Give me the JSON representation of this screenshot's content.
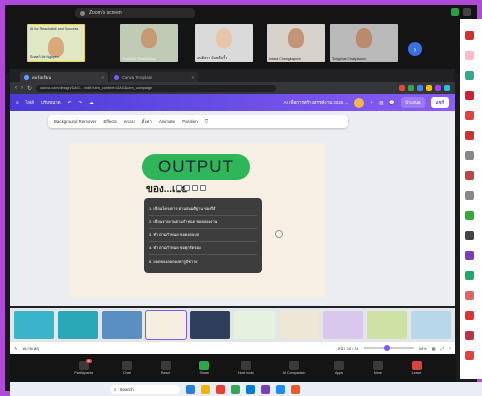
{
  "zoom": {
    "title": "Zoom's screen",
    "participants": [
      {
        "name": "นิเทศก์ Mr.Nguyen",
        "face": "#d9a77a",
        "bg": "#6d7f5a"
      },
      {
        "name": "Yuwadee Phanlamay",
        "face": "#c89a74",
        "bg": "#bfcbb5"
      },
      {
        "name": "อนติสรา นันทตีนรั้ว",
        "face": "#e7c6a8",
        "bg": "#dadada"
      },
      {
        "name": "Intara Changkaporn",
        "face": "#c39476",
        "bg": "#d7d2c9"
      },
      {
        "name": "Tongchai Chaiyaworn",
        "face": "#b98a6c",
        "bg": "#b9b9b9"
      }
    ],
    "active_tile_title": "AI for Reachable and Success"
  },
  "browser": {
    "tabs": [
      {
        "label": "คอร์สเรียน",
        "active": true
      },
      {
        "label": "Canva Template",
        "active": false
      }
    ],
    "url": "canva.com/design/DAG... /edit?utm_content=DAG&utm_campaign",
    "ext_colors": [
      "#e8453c",
      "#34a853",
      "#4285f4",
      "#fbbc05",
      "#a142f4",
      "#24c1e0"
    ]
  },
  "canva": {
    "menu": [
      "ไฟล์",
      "ปรับขนาด"
    ],
    "doc_title": "AI เพื่อการสร้างสรรค์งาน 2025 ...",
    "share_label": "แชร์",
    "present_label": "นำเสนอ",
    "context_toolbar": [
      "Background Remover",
      "Effects",
      "ครอป",
      "ตั้งค่า",
      "Animate",
      "Position"
    ],
    "output_title": "OUTPUT",
    "subtitle": "ของ...เอย",
    "list_items": [
      "1. เขียนโครงการ ตามสมมติฐาน ของรีส์",
      "2. เขียนรายงานตามกำหนด ขอคลองงาน",
      "3. ทำ ตามกำหนด ขอดงตบบล",
      "4. ทำ ตามกำหนด ขอตุกรัดจอง",
      "5. ยอดของลอดองหารูปัชวาย"
    ],
    "page_indicator": "หน้า 26 / 31",
    "zoom_level": "58%",
    "notes_label": "หมายเหตุ"
  },
  "thumbnails": [
    {
      "color": "#3ab4c8"
    },
    {
      "color": "#2aa8b8"
    },
    {
      "color": "#5a8fc4"
    },
    {
      "color": "#f5efe2",
      "selected": true
    },
    {
      "color": "#2f3e5a"
    },
    {
      "color": "#e6f2e0"
    },
    {
      "color": "#efe7d6"
    },
    {
      "color": "#d8c9ec"
    },
    {
      "color": "#cfe2a6"
    },
    {
      "color": "#b7d7ea"
    }
  ],
  "controls": [
    {
      "label": "Participants",
      "color": "#3a3a3a",
      "badge": "21"
    },
    {
      "label": "Chat",
      "color": "#3a3a3a"
    },
    {
      "label": "React",
      "color": "#3a3a3a"
    },
    {
      "label": "Share",
      "color": "#2aa84a"
    },
    {
      "label": "Host tools",
      "color": "#3a3a3a"
    },
    {
      "label": "AI Companion",
      "color": "#3a3a3a"
    },
    {
      "label": "Apps",
      "color": "#3a3a3a"
    },
    {
      "label": "More",
      "color": "#3a3a3a"
    },
    {
      "label": "Leave",
      "color": "#d9433b"
    }
  ],
  "taskbar": {
    "search_placeholder": "Search",
    "apps": [
      "#2b7cd3",
      "#f4b400",
      "#e44134",
      "#34a853",
      "#0078d4",
      "#7b3fb8",
      "#1f8ef1",
      "#f15a24"
    ]
  },
  "right_panel": {
    "colors": [
      "#c33",
      "#fbc",
      "#3a8",
      "#c23",
      "#d44",
      "#c33",
      "#888",
      "#b44",
      "#888",
      "#3a3",
      "#444",
      "#7b3fb8",
      "#2a6",
      "#d66",
      "#d33",
      "#b34",
      "#d44",
      "#3a5"
    ]
  }
}
